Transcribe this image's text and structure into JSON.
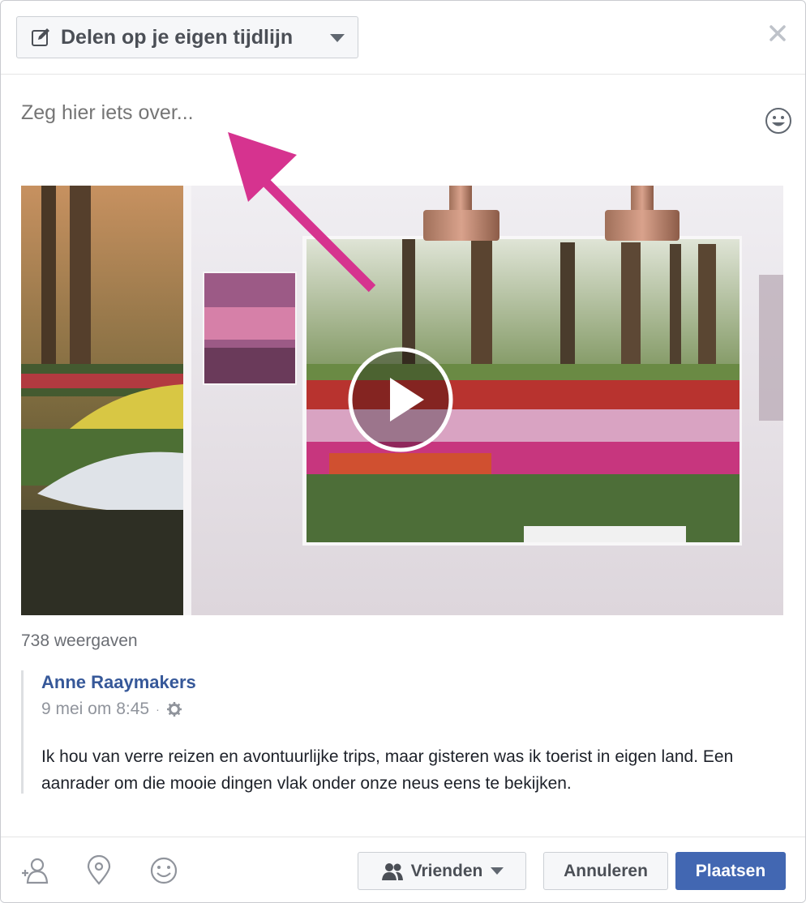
{
  "header": {
    "share_target": "Delen op je eigen tijdlijn",
    "icon_edit": "pencil-square-icon",
    "icon_caret": "chevron-down-icon",
    "icon_close": "close-icon"
  },
  "composer": {
    "placeholder": "Zeg hier iets over...",
    "icon_emoji": "smiley-icon"
  },
  "annotation": {
    "arrow_color": "#d6338f"
  },
  "video": {
    "views": "738 weergaven",
    "icon_play": "play-icon"
  },
  "shared_post": {
    "author": "Anne Raaymakers",
    "date": "9 mei om 8:45",
    "separator": "·",
    "privacy_icon": "gear-icon",
    "text": "Ik hou van verre reizen en avontuurlijke trips, maar gisteren was ik toerist in eigen land. Een aanrader om die mooie dingen vlak onder onze neus eens te bekijken."
  },
  "footer": {
    "icons": [
      "tag-friends-icon",
      "location-icon",
      "feeling-icon"
    ],
    "audience": "Vrienden",
    "cancel": "Annuleren",
    "post": "Plaatsen"
  },
  "colors": {
    "link": "#365899",
    "primary_button": "#4267b2",
    "muted_text": "#90949c"
  }
}
